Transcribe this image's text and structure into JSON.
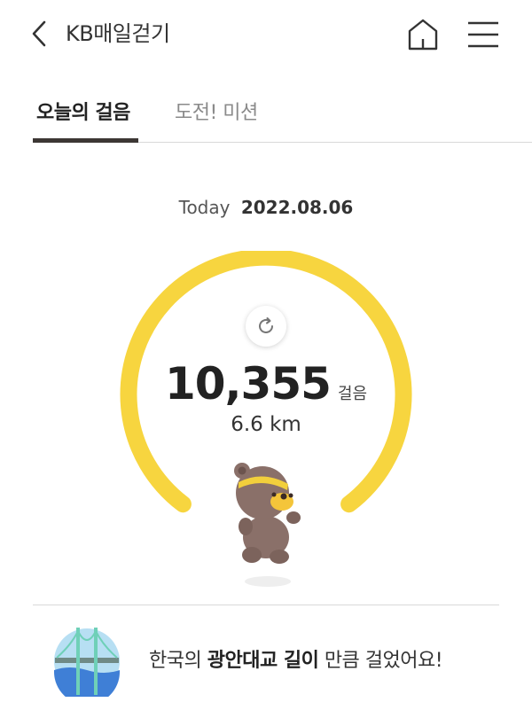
{
  "header": {
    "title": "KB매일걷기",
    "back_icon": "chevron-left-icon",
    "home_icon": "home-icon",
    "menu_icon": "hamburger-menu-icon"
  },
  "tabs": [
    {
      "label": "오늘의 걸음",
      "active": true
    },
    {
      "label": "도전! 미션",
      "active": false
    }
  ],
  "date": {
    "label": "Today",
    "value": "2022.08.06"
  },
  "activity": {
    "steps": "10,355",
    "steps_unit": "걸음",
    "distance": "6.6 km",
    "gauge_color": "#f7d53f",
    "refresh_icon": "refresh-icon"
  },
  "message": {
    "prefix": "한국의 ",
    "highlight": "광안대교 길이",
    "suffix": " 만큼 걸었어요!",
    "icon": "bridge-icon"
  }
}
